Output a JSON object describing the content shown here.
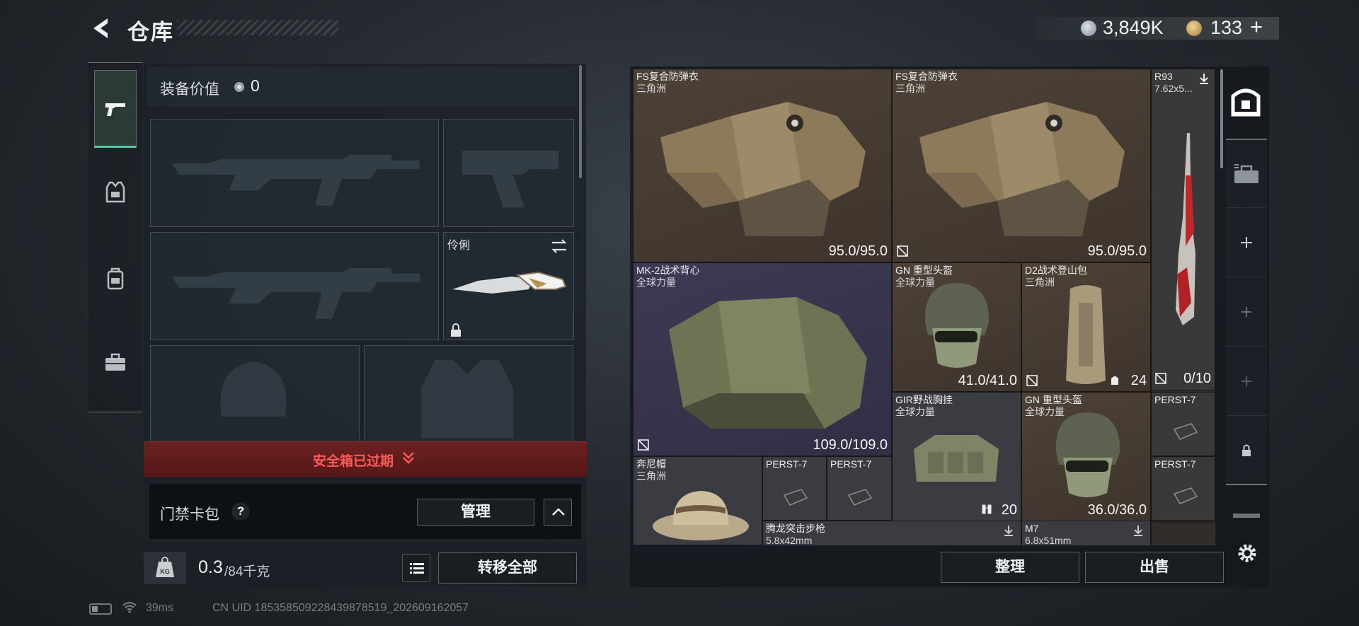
{
  "header": {
    "title": "仓库",
    "currency_silver": "3,849K",
    "currency_gold": "133",
    "gold_plus": "+"
  },
  "left_rail": {
    "tabs": [
      "gun-icon",
      "vest-icon",
      "backpack-icon",
      "toolbox-icon"
    ],
    "active": "gun-icon"
  },
  "equipment": {
    "value_label": "装备价值",
    "value_amount": "0",
    "knife_name": "伶俐",
    "safebox_text": "安全箱已过期",
    "keycard_label": "门禁卡包",
    "keycard_help": "?",
    "manage_label": "管理",
    "weight_current": "0.3",
    "weight_max": "/84千克",
    "transfer_all_label": "转移全部"
  },
  "status": {
    "ping": "39ms",
    "uid": "CN UID 185358509228439878519_202609162057"
  },
  "stash": {
    "items": [
      {
        "name": "FS复合防弹衣",
        "sub": "三角洲",
        "durability": "95.0/95.0"
      },
      {
        "name": "FS复合防弹衣",
        "sub": "三角洲",
        "durability": "95.0/95.0"
      },
      {
        "name": "R93",
        "sub": "7.62x5...",
        "durability": "0/10"
      },
      {
        "name": "MK-2战术背心",
        "sub": "全球力量",
        "durability": "109.0/109.0"
      },
      {
        "name": "GN 重型头盔",
        "sub": "全球力量",
        "durability": "41.0/41.0"
      },
      {
        "name": "D2战术登山包",
        "sub": "三角洲",
        "durability": "24"
      },
      {
        "name": "GIR野战胸挂",
        "sub": "全球力量",
        "durability": "20"
      },
      {
        "name": "GN 重型头盔",
        "sub": "全球力量",
        "durability": "36.0/36.0"
      },
      {
        "name": "PERST-7",
        "sub": "",
        "durability": ""
      },
      {
        "name": "奔尼帽",
        "sub": "三角洲",
        "durability": ""
      },
      {
        "name": "PERST-7",
        "sub": "",
        "durability": ""
      },
      {
        "name": "PERST-7",
        "sub": "",
        "durability": ""
      },
      {
        "name": "PERST-7",
        "sub": "",
        "durability": ""
      },
      {
        "name": "腾龙突击步枪",
        "sub": "5.8x42mm",
        "durability": ""
      },
      {
        "name": "M7",
        "sub": "6.8x51mm",
        "durability": ""
      }
    ],
    "sort_label": "整理",
    "sell_label": "出售"
  },
  "right_rail": {
    "cells": [
      "stash-icon",
      "case-icon",
      "plus-icon",
      "plus-icon",
      "plus-icon",
      "lock-icon",
      "expand-icon"
    ]
  },
  "colors": {
    "accent_green": "#59c9a5",
    "alert_red": "#ff5a5a",
    "item_brown": "#4e4237",
    "item_purple": "#3d3a54"
  }
}
